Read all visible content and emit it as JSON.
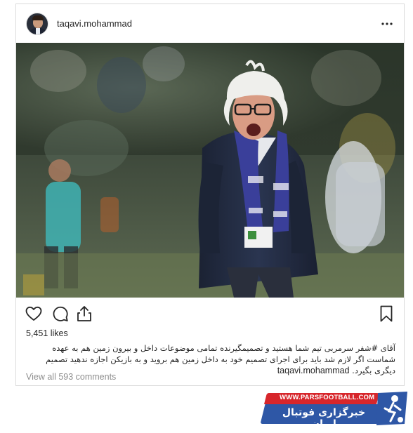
{
  "post": {
    "username": "taqavi.mohammad",
    "more_icon": "more-horizontal-icon",
    "likes": "5,451 likes",
    "caption": {
      "username": "taqavi.mohammad",
      "prefix": "آقای ",
      "hashtag": "#شفر",
      "text": " سرمربی تیم شما هستید و تصمیمگیرنده تمامی موضوعات داخل و بیرون زمین هم به عهده شماست اگر لازم شد باید برای اجرای تصمیم خود به داخل زمین هم بروید و به بازیکن اجازه ندهید تصمیم دیگری بگیرد."
    },
    "view_comments": "View all 593 comments",
    "actions": {
      "like_icon": "heart-icon",
      "comment_icon": "comment-icon",
      "share_icon": "share-icon",
      "save_icon": "bookmark-icon"
    }
  },
  "watermark": {
    "url": "WWW.PARSFOOTBALL.COM",
    "tagline": "خبرگزاری فوتبال ایران"
  }
}
